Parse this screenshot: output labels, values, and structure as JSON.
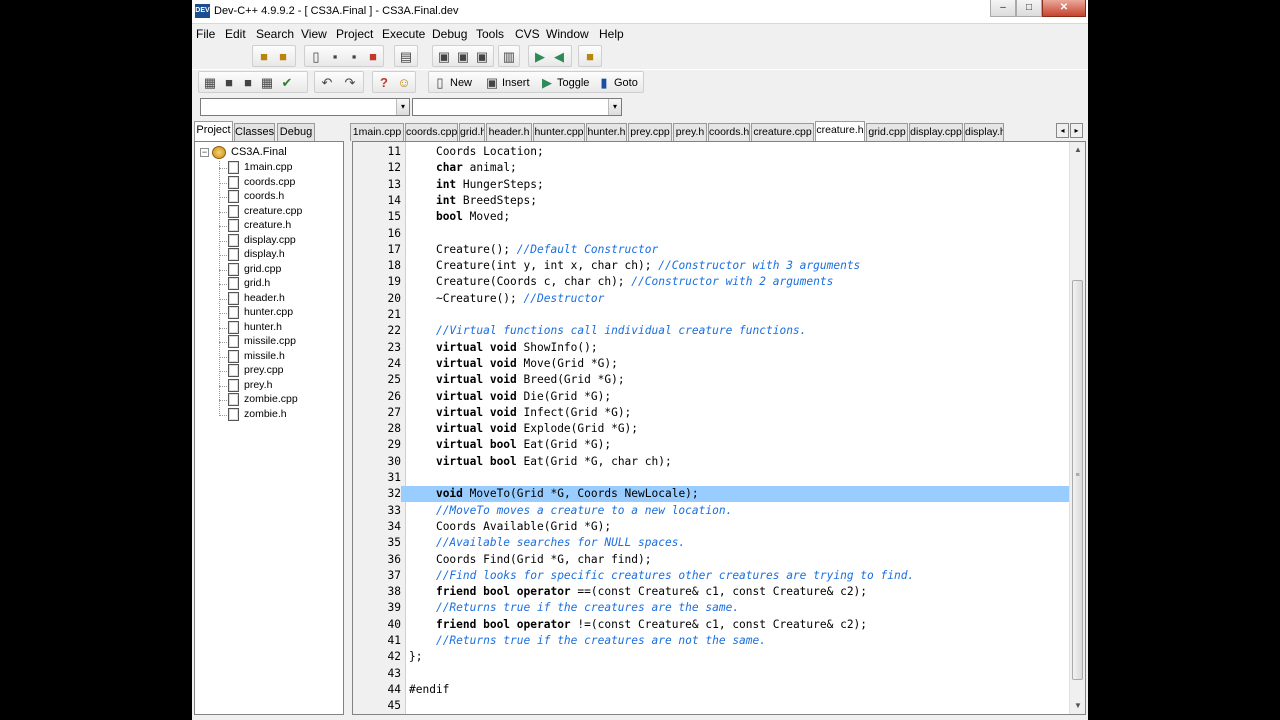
{
  "window": {
    "title": "Dev-C++ 4.9.9.2  -  [ CS3A.Final ] - CS3A.Final.dev",
    "icon_label": "DEV",
    "controls": {
      "minimize": "–",
      "maximize": "□",
      "close": "✕"
    }
  },
  "menu": [
    "File",
    "Edit",
    "Search",
    "View",
    "Project",
    "Execute",
    "Debug",
    "Tools",
    "CVS",
    "Window",
    "Help"
  ],
  "toolbar2": {
    "new": "New",
    "insert": "Insert",
    "toggle": "Toggle",
    "goto": "Goto"
  },
  "icons": {
    "undo": "↶",
    "redo": "↷",
    "help": "?",
    "about": "☺",
    "check": "✔",
    "combo_arrow": "▾",
    "tab_left": "◂",
    "tab_right": "▸",
    "scroll_up": "▲",
    "scroll_down": "▼",
    "expander": "−"
  },
  "combos": {
    "class_value": "",
    "member_value": ""
  },
  "left_tabs": [
    "Project",
    "Classes",
    "Debug"
  ],
  "project": {
    "name": "CS3A.Final",
    "files": [
      "1main.cpp",
      "coords.cpp",
      "coords.h",
      "creature.cpp",
      "creature.h",
      "display.cpp",
      "display.h",
      "grid.cpp",
      "grid.h",
      "header.h",
      "hunter.cpp",
      "hunter.h",
      "missile.cpp",
      "missile.h",
      "prey.cpp",
      "prey.h",
      "zombie.cpp",
      "zombie.h"
    ]
  },
  "editor_tabs": [
    "1main.cpp",
    "coords.cpp",
    "grid.h",
    "header.h",
    "hunter.cpp",
    "hunter.h",
    "prey.cpp",
    "prey.h",
    "coords.h",
    "creature.cpp",
    "creature.h",
    "grid.cpp",
    "display.cpp",
    "display.h"
  ],
  "active_tab_index": 10,
  "current_line": 32,
  "code_lines": [
    {
      "n": "11",
      "indent": "    ",
      "code": "Coords Location;",
      "comment": ""
    },
    {
      "n": "12",
      "indent": "    ",
      "kw": "char",
      "code": " animal;",
      "comment": ""
    },
    {
      "n": "13",
      "indent": "    ",
      "kw": "int",
      "code": " HungerSteps;",
      "comment": ""
    },
    {
      "n": "14",
      "indent": "    ",
      "kw": "int",
      "code": " BreedSteps;",
      "comment": ""
    },
    {
      "n": "15",
      "indent": "    ",
      "kw": "bool",
      "code": " Moved;",
      "comment": ""
    },
    {
      "n": "16",
      "indent": "",
      "code": "",
      "comment": ""
    },
    {
      "n": "17",
      "indent": "    ",
      "code": "Creature(); ",
      "comment": "//Default Constructor"
    },
    {
      "n": "18",
      "indent": "    ",
      "code": "Creature(int y, int x, char ch); ",
      "comment": "//Constructor with 3 arguments"
    },
    {
      "n": "19",
      "indent": "    ",
      "code": "Creature(Coords c, char ch); ",
      "comment": "//Constructor with 2 arguments"
    },
    {
      "n": "20",
      "indent": "    ",
      "code": "~Creature(); ",
      "comment": "//Destructor"
    },
    {
      "n": "21",
      "indent": "",
      "code": "",
      "comment": ""
    },
    {
      "n": "22",
      "indent": "    ",
      "code": "",
      "comment": "//Virtual functions call individual creature functions."
    },
    {
      "n": "23",
      "indent": "    ",
      "kw": "virtual void",
      "code": " ShowInfo();",
      "comment": ""
    },
    {
      "n": "24",
      "indent": "    ",
      "kw": "virtual void",
      "code": " Move(Grid *G);",
      "comment": ""
    },
    {
      "n": "25",
      "indent": "    ",
      "kw": "virtual void",
      "code": " Breed(Grid *G);",
      "comment": ""
    },
    {
      "n": "26",
      "indent": "    ",
      "kw": "virtual void",
      "code": " Die(Grid *G);",
      "comment": ""
    },
    {
      "n": "27",
      "indent": "    ",
      "kw": "virtual void",
      "code": " Infect(Grid *G);",
      "comment": ""
    },
    {
      "n": "28",
      "indent": "    ",
      "kw": "virtual void",
      "code": " Explode(Grid *G);",
      "comment": ""
    },
    {
      "n": "29",
      "indent": "    ",
      "kw": "virtual bool",
      "code": " Eat(Grid *G);",
      "comment": ""
    },
    {
      "n": "30",
      "indent": "    ",
      "kw": "virtual bool",
      "code": " Eat(Grid *G, char ch);",
      "comment": ""
    },
    {
      "n": "31",
      "indent": "",
      "code": "",
      "comment": ""
    },
    {
      "n": "32",
      "indent": "    ",
      "kw": "void",
      "code": " MoveTo(Grid *G, Coords NewLocale);",
      "comment": ""
    },
    {
      "n": "33",
      "indent": "    ",
      "code": "",
      "comment": "//MoveTo moves a creature to a new location."
    },
    {
      "n": "34",
      "indent": "    ",
      "code": "Coords Available(Grid *G);",
      "comment": ""
    },
    {
      "n": "35",
      "indent": "    ",
      "code": "",
      "comment": "//Available searches for NULL spaces."
    },
    {
      "n": "36",
      "indent": "    ",
      "code": "Coords Find(Grid *G, char find);",
      "comment": ""
    },
    {
      "n": "37",
      "indent": "    ",
      "code": "",
      "comment": "//Find looks for specific creatures other creatures are trying to find."
    },
    {
      "n": "38",
      "indent": "    ",
      "kw": "friend bool operator",
      "code": " ==(const Creature& c1, const Creature& c2);",
      "comment": ""
    },
    {
      "n": "39",
      "indent": "    ",
      "code": "",
      "comment": "//Returns true if the creatures are the same."
    },
    {
      "n": "40",
      "indent": "    ",
      "kw": "friend bool operator",
      "code": " !=(const Creature& c1, const Creature& c2);",
      "comment": ""
    },
    {
      "n": "41",
      "indent": "    ",
      "code": "",
      "comment": "//Returns true if the creatures are not the same."
    },
    {
      "n": "42",
      "indent": "",
      "code": "};",
      "comment": ""
    },
    {
      "n": "43",
      "indent": "",
      "code": "",
      "comment": ""
    },
    {
      "n": "44",
      "indent": "",
      "code": "#endif",
      "comment": ""
    },
    {
      "n": "45",
      "indent": "",
      "code": "",
      "comment": ""
    }
  ]
}
